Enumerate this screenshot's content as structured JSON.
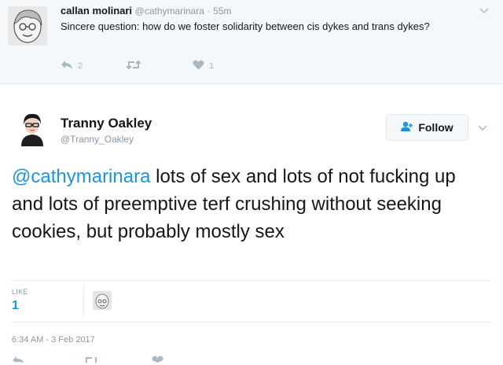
{
  "reply": {
    "name": "callan molinari",
    "handle": "@cathymarinara",
    "separator": "·",
    "time": "55m",
    "text": "Sincere question: how do we foster solidarity between cis dykes and trans dykes?",
    "reply_count": "2",
    "retweet_count": "",
    "like_count": "1"
  },
  "tweet": {
    "name": "Tranny Oakley",
    "handle": "@Tranny_Oakley",
    "follow_label": "Follow",
    "mention": "@cathymarinara",
    "text": " lots of sex and lots of not fucking up and lots of preemptive terf crushing without seeking cookies, but probably mostly sex",
    "likes_label": "LIKE",
    "likes_count": "1",
    "timestamp": "6:34 AM - 3 Feb 2017"
  },
  "colors": {
    "accent": "#1b95e0",
    "muted": "#8899a6",
    "reply_bg": "#f5f8fa",
    "heart": "#aab8c2"
  },
  "icons": {
    "reply": "reply-icon",
    "retweet": "retweet-icon",
    "like": "heart-icon",
    "follow": "add-user-icon",
    "caret": "chevron-down-icon"
  }
}
